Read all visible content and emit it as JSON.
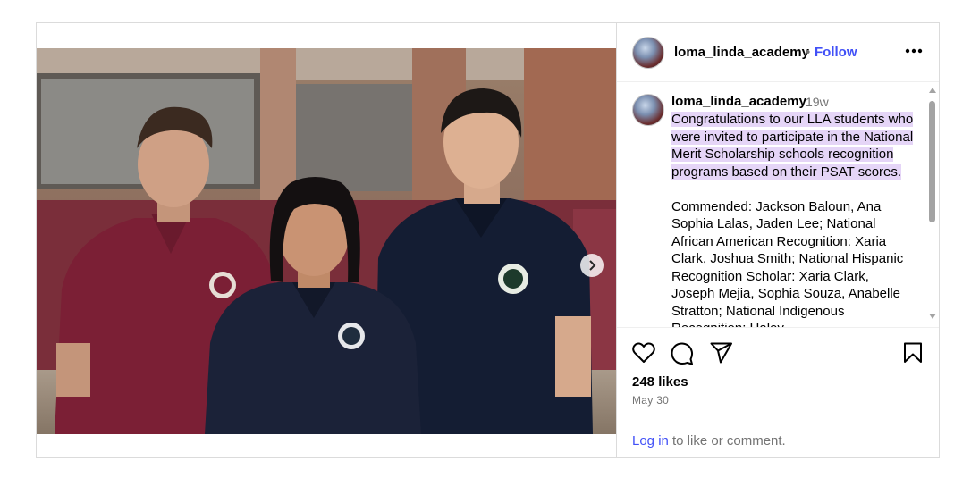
{
  "post": {
    "username": "loma_linda_academy",
    "separator": "•",
    "follow_label": "Follow",
    "more_label": "•••",
    "caption": {
      "username": "loma_linda_academy",
      "time_ago": "19w",
      "highlighted": "Congratulations to our LLA students who were invited to participate in the National Merit Scholarship schools recognition programs based on their PSAT scores.",
      "body": "Commended: Jackson Baloun, Ana Sophia Lalas, Jaden Lee; National African American Recognition: Xaria Clark, Joshua Smith; National Hispanic Recognition Scholar: Xaria Clark, Joseph Mejia, Sophia Souza, Anabelle Stratton; National Indigenous Recognition: Haley"
    },
    "likes": "248 likes",
    "date": "May 30",
    "login_link": "Log in",
    "login_rest": "to like or comment.",
    "carousel": {
      "slide_count": 5,
      "active_index": 0
    },
    "colors": {
      "follow_blue": "#4150f7",
      "highlight": "#e5d5f7",
      "muted_gray": "#737373"
    },
    "icons": {
      "like": "heart-icon",
      "comment": "comment-icon",
      "share": "send-icon",
      "save": "bookmark-icon",
      "next": "chevron-right-icon",
      "more": "more-horizontal-icon"
    }
  }
}
